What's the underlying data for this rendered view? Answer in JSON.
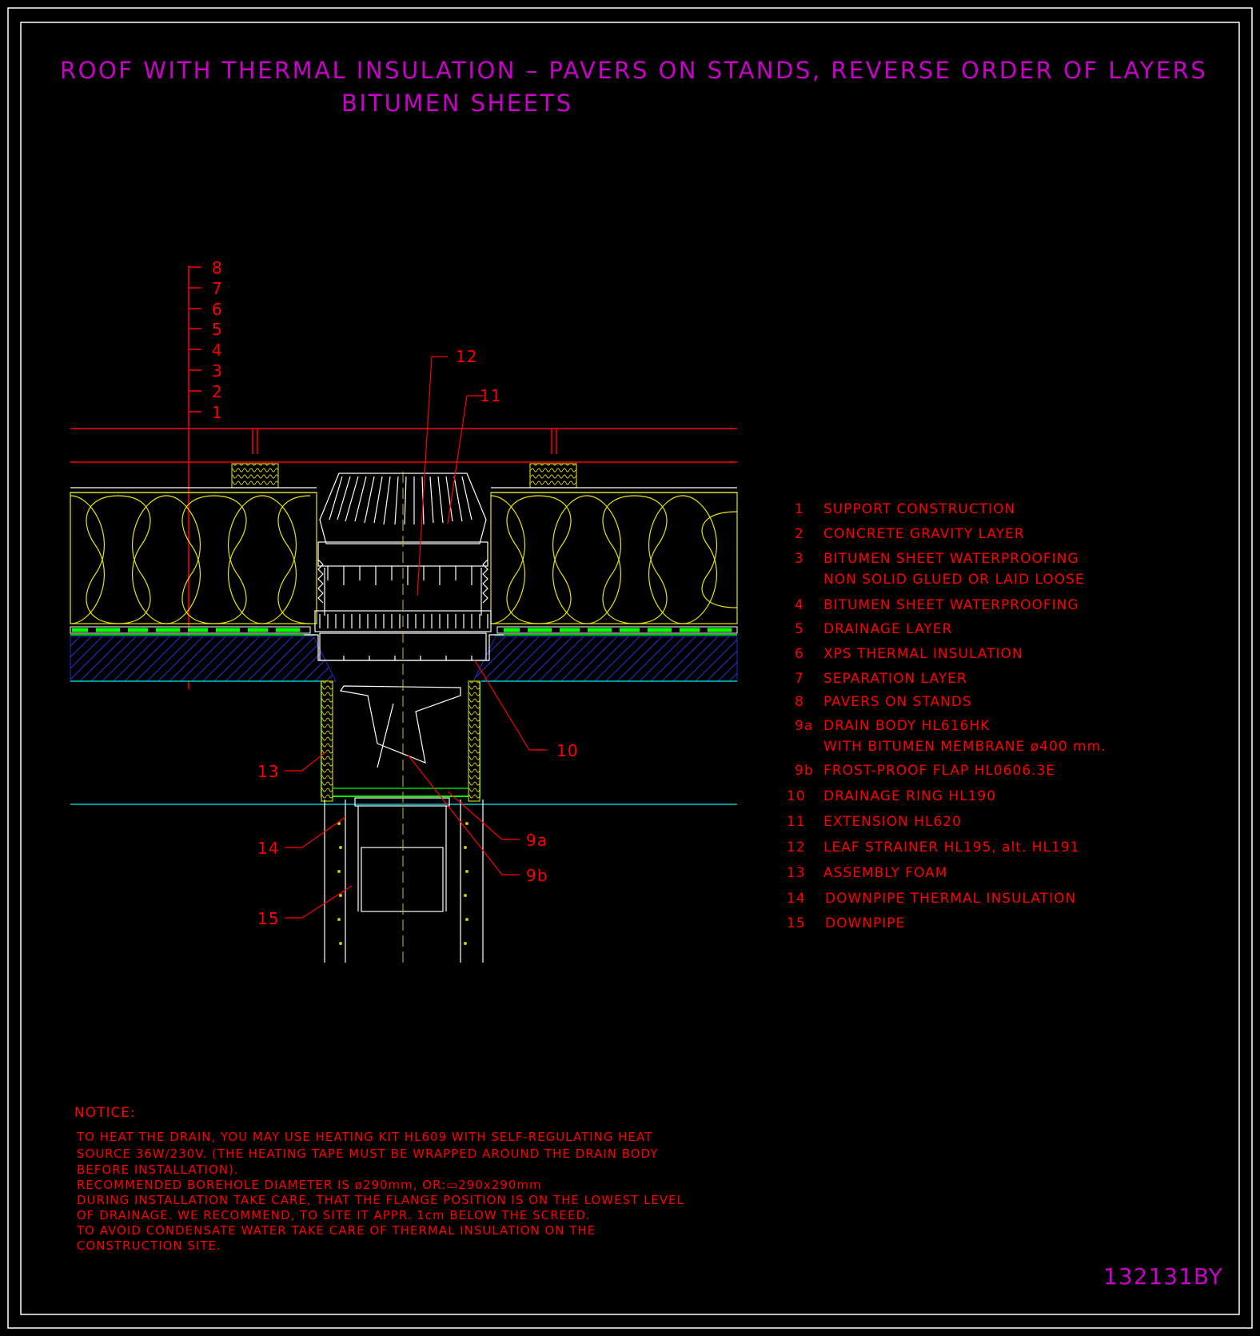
{
  "title": {
    "line1": "ROOF WITH THERMAL INSULATION – PAVERS ON STANDS, REVERSE ORDER OF LAYERS",
    "line2": "BITUMEN SHEETS"
  },
  "layer_scale": [
    "8",
    "7",
    "6",
    "5",
    "4",
    "3",
    "2",
    "1"
  ],
  "callouts": {
    "c12": "12",
    "c11": "11",
    "c10": "10",
    "c13": "13",
    "c14": "14",
    "c15": "15",
    "c9a": "9a",
    "c9b": "9b"
  },
  "legend": [
    {
      "num": "1",
      "text": "SUPPORT CONSTRUCTION"
    },
    {
      "num": "2",
      "text": "CONCRETE GRAVITY LAYER"
    },
    {
      "num": "3",
      "text": "BITUMEN SHEET WATERPROOFING",
      "text2": "NON SOLID GLUED OR LAID LOOSE"
    },
    {
      "num": "4",
      "text": "BITUMEN SHEET WATERPROOFING"
    },
    {
      "num": "5",
      "text": "DRAINAGE LAYER"
    },
    {
      "num": "6",
      "text": "XPS THERMAL INSULATION"
    },
    {
      "num": "7",
      "text": "SEPARATION LAYER"
    },
    {
      "num": "8",
      "text": "PAVERS ON STANDS"
    },
    {
      "num": "9a",
      "text": "DRAIN BODY HL616HK",
      "text2": "WITH BITUMEN MEMBRANE ø400 mm."
    },
    {
      "num": "9b",
      "text": "FROST-PROOF FLAP HL0606.3E"
    },
    {
      "num": "10",
      "text": "DRAINAGE RING HL190"
    },
    {
      "num": "11",
      "text": "EXTENSION HL620"
    },
    {
      "num": "12",
      "text": "LEAF STRAINER HL195, alt. HL191"
    },
    {
      "num": "13",
      "text": "ASSEMBLY FOAM"
    },
    {
      "num": "14",
      "text": "DOWNPIPE THERMAL INSULATION"
    },
    {
      "num": "15",
      "text": "DOWNPIPE"
    }
  ],
  "notice": {
    "heading": "NOTICE:",
    "lines": [
      "TO HEAT THE DRAIN, YOU MAY USE HEATING KIT HL609 WITH SELF-REGULATING HEAT",
      "SOURCE 36W/230V. (THE HEATING TAPE MUST BE WRAPPED AROUND THE DRAIN BODY",
      "BEFORE INSTALLATION).",
      "RECOMMENDED BOREHOLE DIAMETER IS ø290mm, OR:▭290x290mm",
      "DURING INSTALLATION TAKE CARE, THAT THE FLANGE POSITION IS ON THE LOWEST LEVEL",
      "OF DRAINAGE. WE RECOMMEND, TO SITE IT APPR. 1cm BELOW THE SCREED.",
      "TO AVOID CONDENSATE WATER TAKE CARE OF THERMAL INSULATION ON THE",
      "CONSTRUCTION SITE."
    ]
  },
  "drawing_code": "132131BY",
  "colors": {
    "background": "#000000",
    "frame": "#ffffff",
    "labels": "#ff0000",
    "title": "#c800c8",
    "insulation": "#ffff00",
    "membrane": "#00ff00",
    "substrate": "#00c8c8",
    "concrete_hatch": "#2828c8",
    "drain_parts": "#ffffff"
  }
}
